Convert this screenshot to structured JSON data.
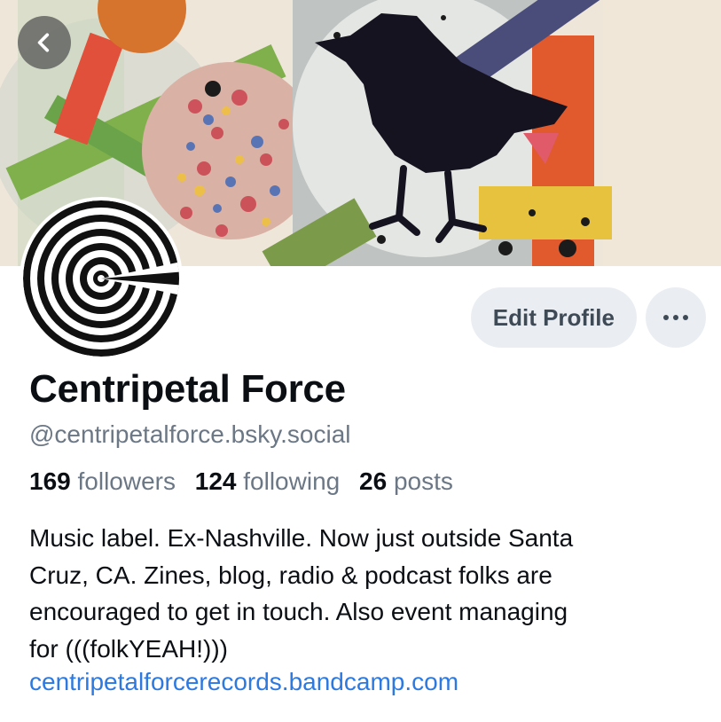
{
  "profile": {
    "display_name": "Centripetal Force",
    "handle": "@centripetalforce.bsky.social",
    "bio_lines": [
      "Music label. Ex-Nashville. Now just outside Santa",
      "Cruz, CA. Zines, blog, radio & podcast folks are",
      "encouraged to get in touch. Also event managing",
      "for (((folkYEAH!)))"
    ],
    "link": "centripetalforcerecords.bandcamp.com"
  },
  "stats": {
    "followers_count": "169",
    "followers_label": "followers",
    "following_count": "124",
    "following_label": "following",
    "posts_count": "26",
    "posts_label": "posts"
  },
  "actions": {
    "edit_profile_label": "Edit Profile",
    "more_icon": "ellipsis-icon",
    "back_icon": "chevron-left-icon"
  },
  "colors": {
    "accent_link": "#2e79e0",
    "secondary_text": "#6b7785",
    "button_bg": "#eaedf1"
  }
}
